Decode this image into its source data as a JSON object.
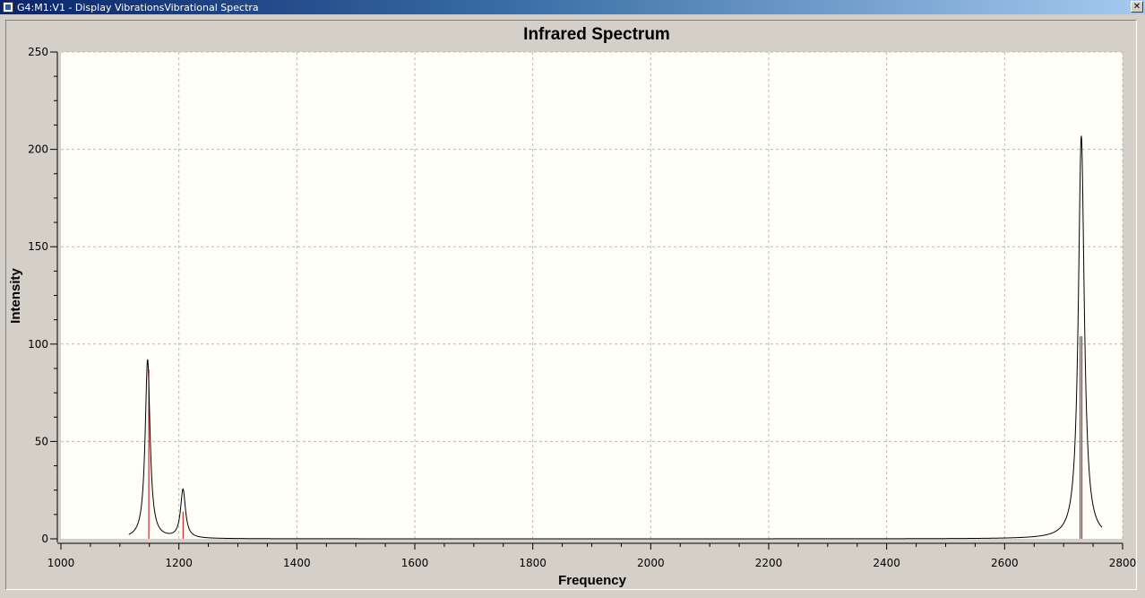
{
  "window": {
    "title": "G4:M1:V1 - Display VibrationsVibrational Spectra",
    "close_glyph": "✕"
  },
  "chart_data": {
    "type": "line",
    "title": "Infrared Spectrum",
    "xlabel": "Frequency",
    "ylabel": "Intensity",
    "xlim": [
      1000,
      2800
    ],
    "ylim": [
      0,
      250
    ],
    "x_ticks": [
      1000,
      1200,
      1400,
      1600,
      1800,
      2000,
      2200,
      2400,
      2600,
      2800
    ],
    "y_ticks": [
      0,
      50,
      100,
      150,
      200,
      250
    ],
    "grid": true,
    "plot_background": "#fffff8",
    "line_color": "#000000",
    "stick_color": "#c00000",
    "curve_range": [
      1115,
      2765
    ],
    "peaks": [
      {
        "x": 1147,
        "curve_height": 92,
        "stick_height": 87,
        "width": 5
      },
      {
        "x": 1207,
        "curve_height": 25,
        "stick_height": 14,
        "width": 5
      },
      {
        "x": 2730,
        "curve_height": 207,
        "stick_height": 104,
        "width": 6
      }
    ],
    "sticks": [
      {
        "x": 1149,
        "intensity": 87
      },
      {
        "x": 1207,
        "intensity": 14
      },
      {
        "x": 2728,
        "intensity": 104
      },
      {
        "x": 2731,
        "intensity": 104
      }
    ]
  }
}
